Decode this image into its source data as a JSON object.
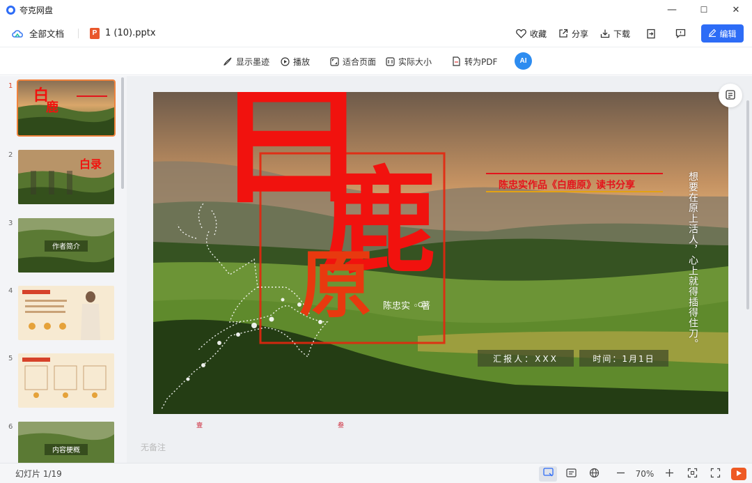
{
  "app": {
    "title": "夸克网盘"
  },
  "window": {
    "minimize": "—",
    "maximize": "☐",
    "close": "✕"
  },
  "header": {
    "all_docs": "全部文档",
    "file_name": "1 (10).pptx",
    "actions": {
      "favorite": "收藏",
      "share": "分享",
      "download": "下载",
      "edit": "编辑"
    }
  },
  "toolbar": {
    "show_ink": "显示墨迹",
    "play": "播放",
    "fit_page": "适合页面",
    "actual_size": "实际大小",
    "to_pdf": "转为PDF",
    "ai_label": "AI"
  },
  "thumbnails": [
    {
      "number": "1",
      "title": "白鹿原"
    },
    {
      "number": "2",
      "title": "目录"
    },
    {
      "number": "3",
      "title": "作者简介"
    },
    {
      "number": "4",
      "title": "作者简介"
    },
    {
      "number": "5",
      "title": "作者思想"
    },
    {
      "number": "6",
      "title": "内容梗概"
    }
  ],
  "slide": {
    "title_chars": [
      "白",
      "鹿",
      "原"
    ],
    "subtitle": "陈忠实作品《白鹿原》读书分享",
    "author": "陈忠实 ◦ 著",
    "vertical_quote": "想要在原上活人，心上就得插得住刀。",
    "reporter": "汇报人：XXX",
    "time": "时间：1月1日",
    "mini_marks": [
      "壹",
      "叁"
    ]
  },
  "notes": "无备注",
  "status": {
    "slide_counter": "幻灯片 1/19",
    "zoom": "70%"
  },
  "colors": {
    "accent": "#2d6cf6",
    "title_red": "#f1120e",
    "play_orange": "#ee5a24"
  }
}
